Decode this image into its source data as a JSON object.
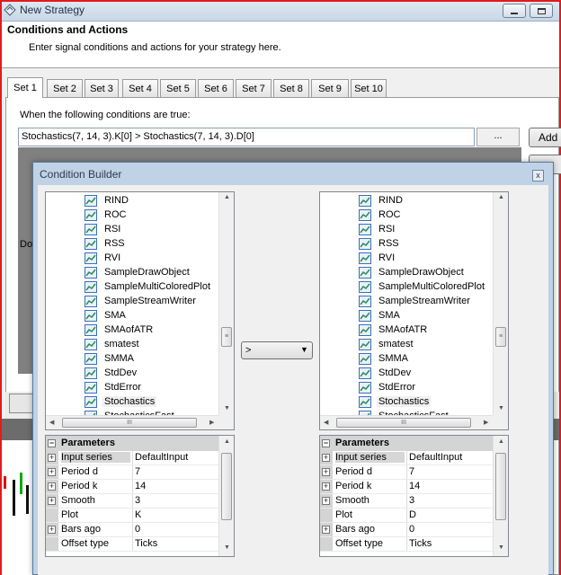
{
  "window": {
    "title": "New Strategy",
    "header_title": "Conditions and Actions",
    "header_subtitle": "Enter signal conditions and actions for your strategy here."
  },
  "tabs": [
    "Set 1",
    "Set 2",
    "Set 3",
    "Set 4",
    "Set 5",
    "Set 6",
    "Set 7",
    "Set 8",
    "Set 9",
    "Set 10"
  ],
  "active_tab": "Set 1",
  "conditions": {
    "label": "When the following conditions are true:",
    "value": "Stochastics(7, 14, 3).K[0] > Stochastics(7, 14, 3).D[0]",
    "browse_label": "...",
    "add_label": "Add",
    "do_label": "Do"
  },
  "dialog": {
    "title": "Condition Builder",
    "close_glyph": "x",
    "operator": ">",
    "left_list": {
      "items": [
        "RIND",
        "ROC",
        "RSI",
        "RSS",
        "RVI",
        "SampleDrawObject",
        "SampleMultiColoredPlot",
        "SampleStreamWriter",
        "SMA",
        "SMAofATR",
        "smatest",
        "SMMA",
        "StdDev",
        "StdError",
        "Stochastics",
        "StochasticsFast"
      ],
      "selected": "Stochastics"
    },
    "right_list": {
      "items": [
        "RIND",
        "ROC",
        "RSI",
        "RSS",
        "RVI",
        "SampleDrawObject",
        "SampleMultiColoredPlot",
        "SampleStreamWriter",
        "SMA",
        "SMAofATR",
        "smatest",
        "SMMA",
        "StdDev",
        "StdError",
        "Stochastics",
        "StochasticsFast"
      ],
      "selected": "Stochastics"
    },
    "left_params": {
      "category": "Parameters",
      "rows": [
        {
          "name": "Input series",
          "value": "DefaultInput",
          "expandable": true
        },
        {
          "name": "Period d",
          "value": "7",
          "expandable": true
        },
        {
          "name": "Period k",
          "value": "14",
          "expandable": true
        },
        {
          "name": "Smooth",
          "value": "3",
          "expandable": true
        },
        {
          "name": "Plot",
          "value": "K",
          "expandable": false
        },
        {
          "name": "Bars ago",
          "value": "0",
          "expandable": true
        },
        {
          "name": "Offset type",
          "value": "Ticks",
          "expandable": false
        }
      ]
    },
    "right_params": {
      "category": "Parameters",
      "rows": [
        {
          "name": "Input series",
          "value": "DefaultInput",
          "expandable": true
        },
        {
          "name": "Period d",
          "value": "7",
          "expandable": true
        },
        {
          "name": "Period k",
          "value": "14",
          "expandable": true
        },
        {
          "name": "Smooth",
          "value": "3",
          "expandable": true
        },
        {
          "name": "Plot",
          "value": "D",
          "expandable": false
        },
        {
          "name": "Bars ago",
          "value": "0",
          "expandable": true
        },
        {
          "name": "Offset type",
          "value": "Ticks",
          "expandable": false
        }
      ]
    }
  },
  "scrollbar_glyphs": {
    "up": "▲",
    "down": "▼",
    "left": "◀",
    "right": "▶",
    "grip": "≡",
    "hgrip": "III"
  },
  "expander_glyph": "+",
  "colors": {
    "outer_border": "#e21b1b",
    "dialog_frame": "#bfd2e6",
    "icon_green": "#2e8b57",
    "icon_blue": "#3b6fb6"
  },
  "icons": {
    "list_item": "indicator-chart-icon",
    "title": "strategy-icon"
  }
}
